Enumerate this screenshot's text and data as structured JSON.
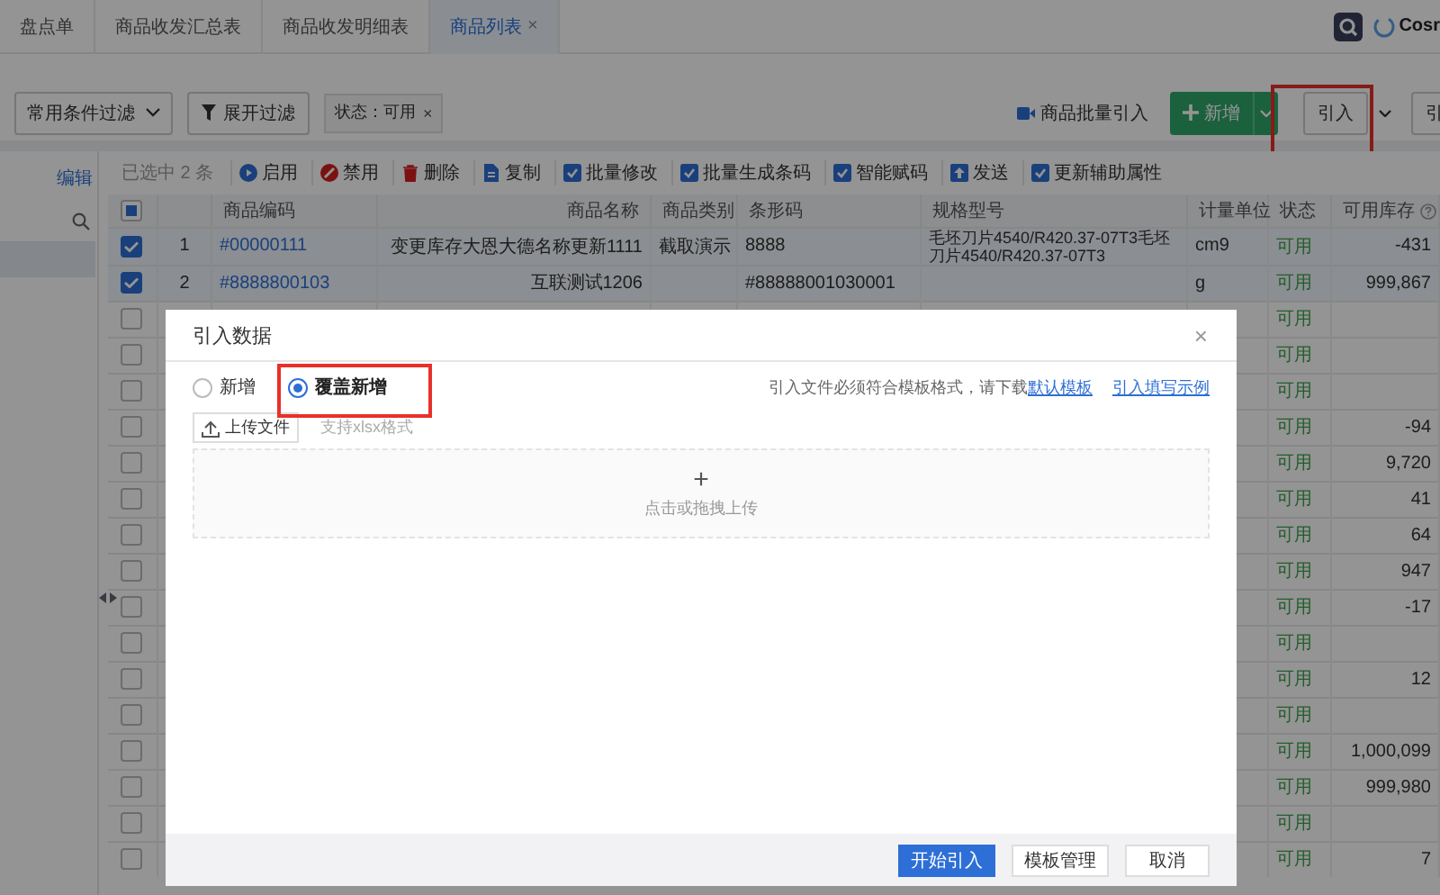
{
  "tabs": [
    {
      "label": "盘点单",
      "selected": false
    },
    {
      "label": "商品收发汇总表",
      "selected": false
    },
    {
      "label": "商品收发明细表",
      "selected": false
    },
    {
      "label": "商品列表",
      "selected": true,
      "close": "×"
    }
  ],
  "brand": {
    "text": "Cosr"
  },
  "filter_bar": {
    "dropdown": "常用条件过滤",
    "expand_button": "展开过滤",
    "tags": [
      {
        "label": "状态：可用",
        "remove": "×"
      }
    ]
  },
  "actions": [
    {
      "kind": "video_link",
      "label": "商品批量引入"
    },
    {
      "kind": "primary_split",
      "label": "新增"
    },
    {
      "kind": "split",
      "label": "引入",
      "highlighted": true
    },
    {
      "kind": "plain",
      "label": "引"
    }
  ],
  "sidebar": {
    "edit_link": "编辑"
  },
  "toolbar": {
    "selection": "已选中 2 条",
    "buttons": [
      {
        "kind": "play",
        "label": "启用"
      },
      {
        "kind": "ban",
        "label": "禁用"
      },
      {
        "kind": "trash",
        "label": "删除"
      },
      {
        "kind": "doc",
        "label": "复制"
      },
      {
        "kind": "check",
        "label": "批量修改"
      },
      {
        "kind": "check",
        "label": "批量生成条码"
      },
      {
        "kind": "check",
        "label": "智能赋码"
      },
      {
        "kind": "send",
        "label": "发送"
      },
      {
        "kind": "check",
        "label": "更新辅助属性"
      }
    ]
  },
  "table": {
    "header_partial": true,
    "columns": [
      "商品编码",
      "商品名称",
      "商品类别",
      "条形码",
      "规格型号",
      "计量单位",
      "状态",
      "可用库存"
    ],
    "rows": [
      {
        "checked": true,
        "index": "1",
        "code": "#00000111",
        "name": "变更库存大恩大德名称更新1111",
        "category": "截取演示",
        "barcode": "8888",
        "spec": "毛坯刀片4540/R420.37-07T3毛坯刀片4540/R420.37-07T3",
        "unit": "cm9",
        "status": "可用",
        "stock": "-431"
      },
      {
        "checked": true,
        "index": "2",
        "code": "#8888800103",
        "name": "互联测试1206",
        "barcode": "#88888001030001",
        "unit": "g",
        "status": "可用",
        "stock": "999,867"
      },
      {
        "checked": false,
        "status": "可用"
      },
      {
        "checked": false,
        "status": "可用"
      },
      {
        "checked": false,
        "status": "可用"
      },
      {
        "checked": false,
        "status": "可用",
        "stock": "-94"
      },
      {
        "checked": false,
        "status": "可用",
        "stock": "9,720"
      },
      {
        "checked": false,
        "status": "可用",
        "stock": "41"
      },
      {
        "checked": false,
        "status": "可用",
        "stock": "64"
      },
      {
        "checked": false,
        "status": "可用",
        "stock": "947"
      },
      {
        "checked": false,
        "status": "可用",
        "stock": "-17"
      },
      {
        "checked": false,
        "status": "可用"
      },
      {
        "checked": false,
        "status": "可用",
        "stock": "12"
      },
      {
        "checked": false,
        "status": "可用"
      },
      {
        "checked": false,
        "status": "可用",
        "stock": "1,000,099"
      },
      {
        "checked": false,
        "status": "可用",
        "stock": "999,980"
      },
      {
        "checked": false,
        "status": "可用"
      },
      {
        "checked": false,
        "status": "可用",
        "stock": "7"
      }
    ]
  },
  "dialog": {
    "title": "引入数据",
    "close": "×",
    "modes": [
      {
        "label": "新增",
        "selected": false,
        "highlighted": false
      },
      {
        "label": "覆盖新增",
        "selected": true,
        "highlighted": true
      }
    ],
    "hint": "引入文件必须符合模板格式，请下载",
    "links": [
      "默认模板",
      "引入填写示例"
    ],
    "upload_button": "上传文件",
    "format_note": "支持xlsx格式",
    "dropzone": {
      "plus": "+",
      "text": "点击或拖拽上传"
    },
    "buttons": [
      {
        "kind": "primary",
        "label": "开始引入"
      },
      {
        "kind": "default",
        "label": "模板管理"
      },
      {
        "kind": "default",
        "label": "取消"
      }
    ]
  }
}
